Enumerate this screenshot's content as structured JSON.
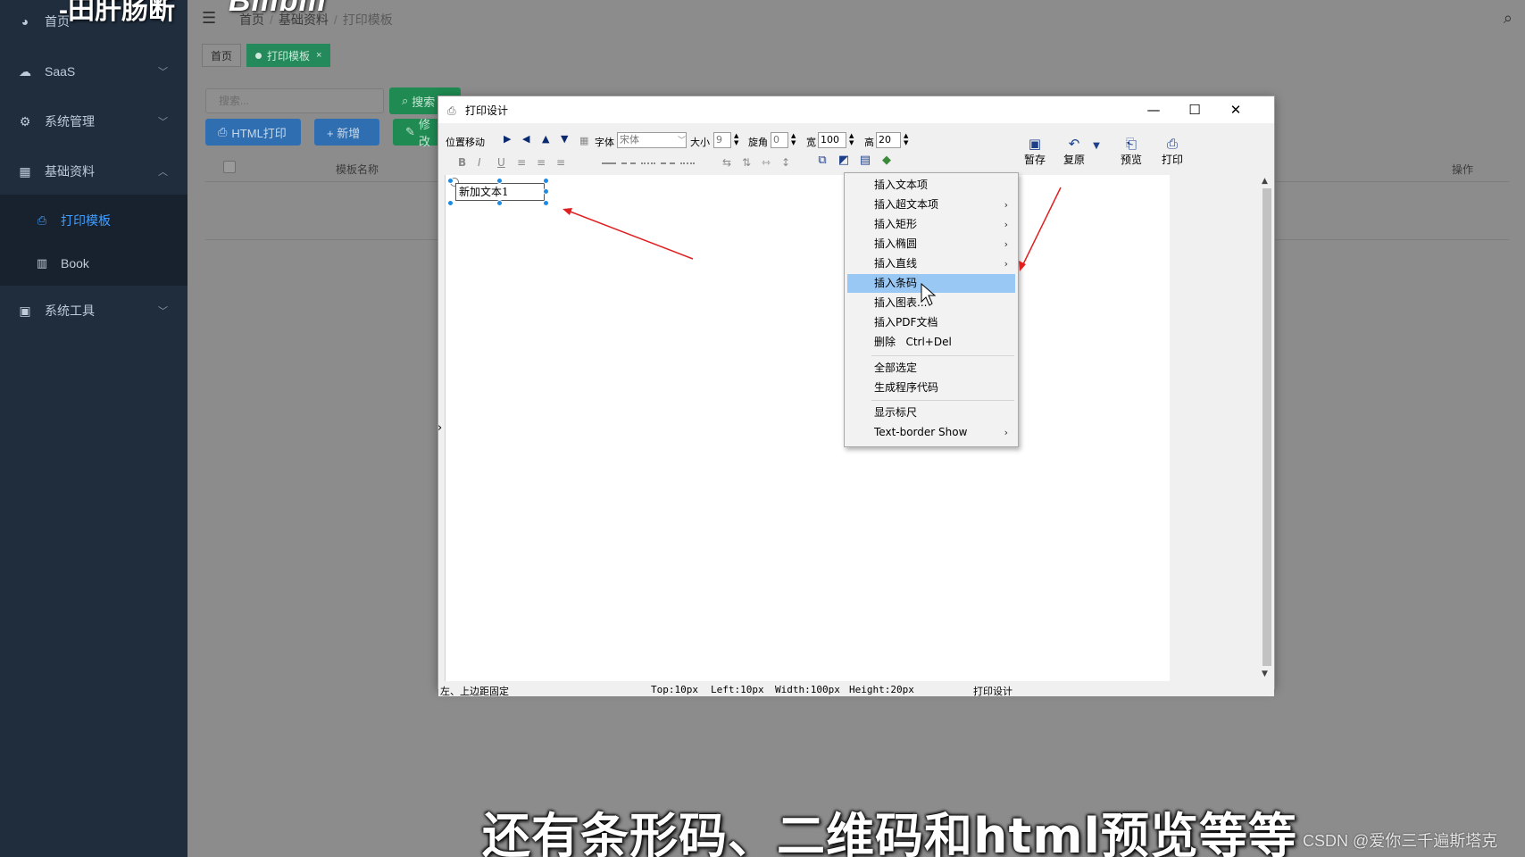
{
  "sidebar": {
    "items": [
      {
        "label": "首页",
        "icon": "dashboard-icon"
      },
      {
        "label": "SaaS",
        "icon": "cloud-icon"
      },
      {
        "label": "系统管理",
        "icon": "gear-icon"
      },
      {
        "label": "基础资料",
        "icon": "grid-icon"
      },
      {
        "label": "系统工具",
        "icon": "toolbox-icon"
      }
    ],
    "sub_items": [
      {
        "label": "打印模板",
        "icon": "printer-icon"
      },
      {
        "label": "Book",
        "icon": "bar-chart-icon"
      }
    ]
  },
  "header": {
    "breadcrumb": [
      "首页",
      "基础资料",
      "打印模板"
    ]
  },
  "tabs": [
    {
      "label": "首页"
    },
    {
      "label": "打印模板"
    }
  ],
  "toolbar_main": {
    "search_placeholder": "搜索...",
    "search_button": "搜索",
    "html_print_button": "HTML打印",
    "add_button": "+ 新增",
    "edit_button": "修改"
  },
  "table": {
    "columns": [
      "模板名称",
      "操作"
    ]
  },
  "dialog": {
    "title": "打印设计",
    "toolbar": {
      "position_move_label": "位置移动",
      "font_label": "字体",
      "font_value": "宋体",
      "size_label": "大小",
      "size_value": "9",
      "rotate_label": "旋角",
      "rotate_value": "0",
      "width_label": "宽",
      "width_value": "100",
      "height_label": "高",
      "height_value": "20",
      "save_label": "暂存",
      "restore_label": "复原",
      "preview_label": "预览",
      "print_label": "打印"
    },
    "text_item": "新加文本1",
    "status": {
      "anchor": "左、上边距固定",
      "top": "Top:10px",
      "left": "Left:10px",
      "width": "Width:100px",
      "height": "Height:20px",
      "mode": "打印设计"
    }
  },
  "context_menu": {
    "items": [
      {
        "label": "插入文本项",
        "has_sub": false
      },
      {
        "label": "插入超文本项",
        "has_sub": true
      },
      {
        "label": "插入矩形",
        "has_sub": true
      },
      {
        "label": "插入椭圆",
        "has_sub": true
      },
      {
        "label": "插入直线",
        "has_sub": true
      },
      {
        "label": "插入条码",
        "has_sub": false,
        "highlighted": true
      },
      {
        "label": "插入图表...",
        "has_sub": false
      },
      {
        "label": "插入PDF文档",
        "has_sub": false
      },
      {
        "label": "删除   Ctrl+Del",
        "has_sub": false
      },
      {
        "label": "全部选定",
        "has_sub": false
      },
      {
        "label": "生成程序代码",
        "has_sub": false
      },
      {
        "label": "显示标尺",
        "has_sub": false
      },
      {
        "label": "Text-border Show",
        "has_sub": true
      }
    ],
    "submenu_arrow": "›"
  },
  "overlay": {
    "subtitle": "还有条形码、二维码和html预览等等",
    "watermark": "CSDN @爱你三千遍斯塔克",
    "logo_text": "-田肝肠断",
    "bili_text": "Bilibili"
  },
  "colors": {
    "sidebar_bg": "#1f2d3d",
    "active_link": "#409eff",
    "menu_highlight": "#99c8f5",
    "arrow_red": "#e02020"
  }
}
